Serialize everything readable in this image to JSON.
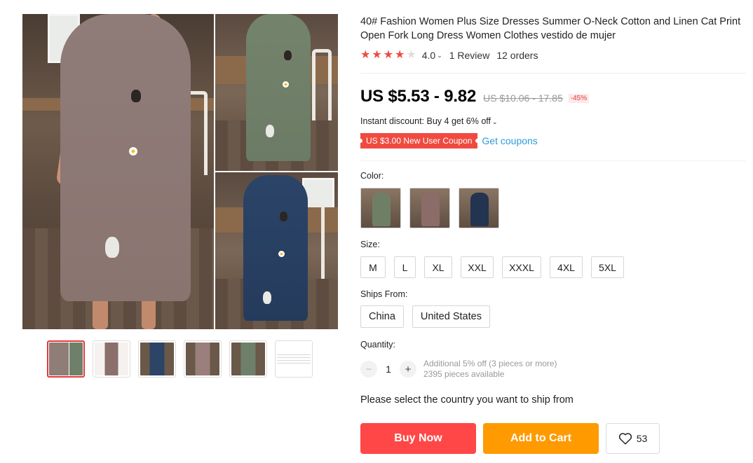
{
  "product": {
    "title": "40# Fashion Women Plus Size Dresses Summer O-Neck Cotton and Linen Cat Print Open Fork Long Dress Women Clothes vestido de mujer",
    "rating": {
      "value": "4.0",
      "stars_filled": 4,
      "stars_total": 5,
      "reviews": "1 Review",
      "orders": "12 orders"
    },
    "price": {
      "current": "US $5.53 - 9.82",
      "original": "US $10.06 - 17.85",
      "discount": "-45%"
    },
    "instant_discount": "Instant discount: Buy 4 get 6% off",
    "coupon": {
      "label": "US $3.00 New User Coupon",
      "link": "Get coupons"
    }
  },
  "gallery": {
    "main_image_alt": "product-photo-collage",
    "thumbnails": [
      {
        "name": "thumb-collage",
        "active": true,
        "colors": [
          "#6a5a4e",
          "#8f7d78"
        ]
      },
      {
        "name": "thumb-pink-dress",
        "active": false,
        "colors": [
          "#f5f1ee",
          "#8b6f6a"
        ]
      },
      {
        "name": "thumb-blue-dress",
        "active": false,
        "colors": [
          "#6a5848",
          "#2c4466"
        ]
      },
      {
        "name": "thumb-mauve-dress",
        "active": false,
        "colors": [
          "#6a5848",
          "#9a7f7d"
        ]
      },
      {
        "name": "thumb-green-dress",
        "active": false,
        "colors": [
          "#6a5848",
          "#6f806a"
        ]
      },
      {
        "name": "thumb-size-chart",
        "active": false,
        "colors": [
          "#ffffff",
          "#cccccc"
        ]
      }
    ]
  },
  "options": {
    "color": {
      "label": "Color:",
      "items": [
        {
          "name": "green",
          "color": "#6f7f66"
        },
        {
          "name": "mauve",
          "color": "#8b6c69"
        },
        {
          "name": "navy",
          "color": "#22344f"
        }
      ]
    },
    "size": {
      "label": "Size:",
      "items": [
        "M",
        "L",
        "XL",
        "XXL",
        "XXXL",
        "4XL",
        "5XL"
      ]
    },
    "ships_from": {
      "label": "Ships From:",
      "items": [
        "China",
        "United States"
      ]
    },
    "quantity": {
      "label": "Quantity:",
      "value": "1",
      "minus": "−",
      "plus": "+",
      "info_line1": "Additional 5% off (3 pieces or more)",
      "info_line2": "2395 pieces available"
    }
  },
  "ship_note": "Please select the country you want to ship from",
  "actions": {
    "buy_now": "Buy Now",
    "add_to_cart": "Add to Cart",
    "wishlist_count": "53"
  },
  "icons": {
    "star": "star-icon",
    "chevron": "chevron-down-icon",
    "heart": "heart-icon"
  },
  "colors": {
    "accent_red": "#ff4747",
    "accent_orange": "#ff9a00",
    "star_red": "#f04a40",
    "link_blue": "#2e9cd8"
  }
}
